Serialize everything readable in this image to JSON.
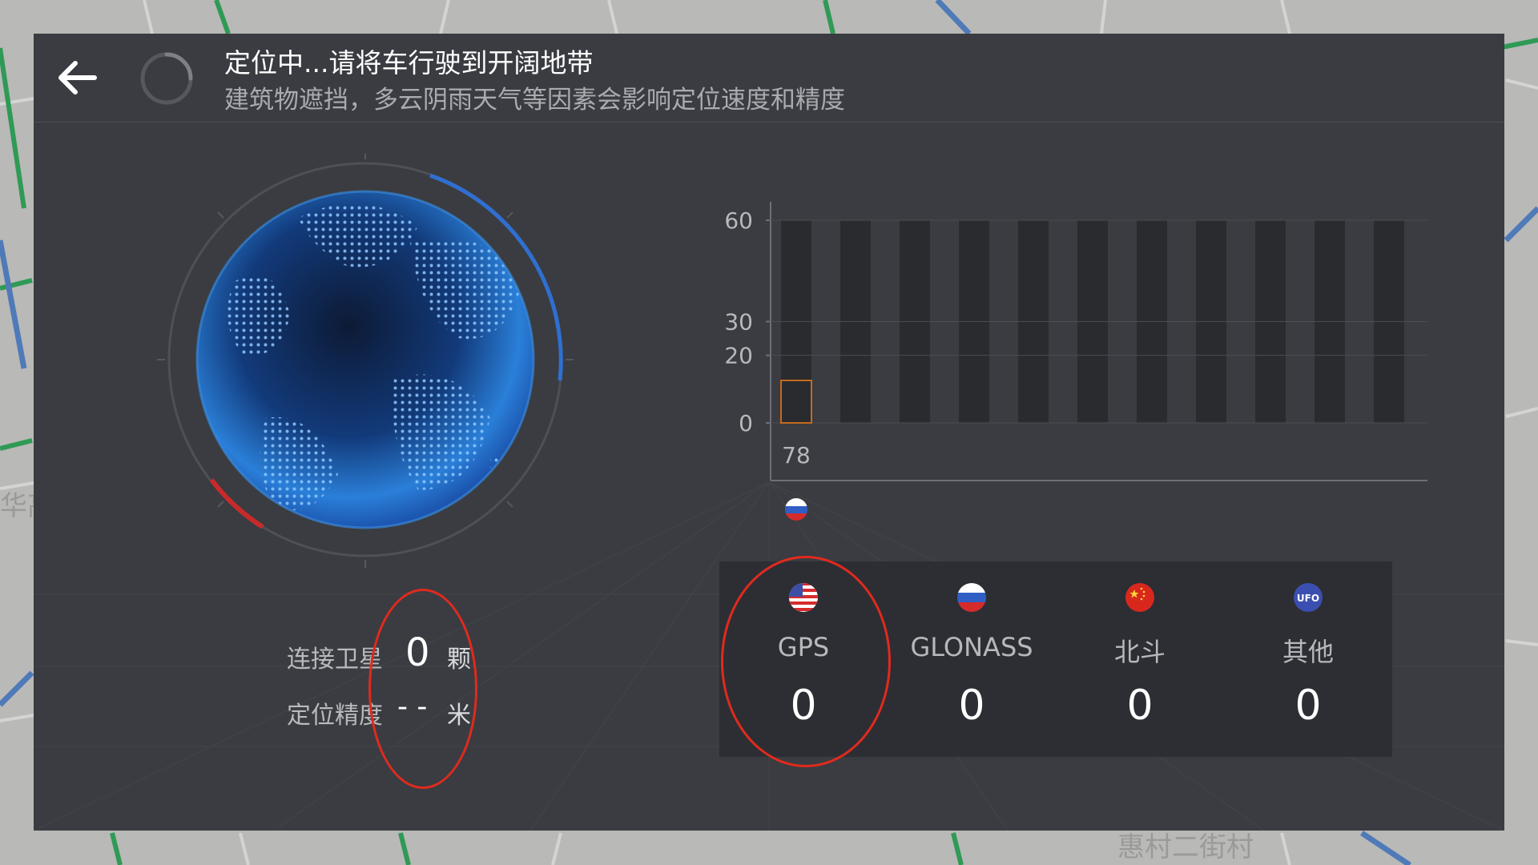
{
  "header": {
    "title": "定位中...请将车行驶到开阔地带",
    "subtitle": "建筑物遮挡，多云阴雨天气等因素会影响定位速度和精度"
  },
  "map_labels": [
    "华高",
    "惠村二街村"
  ],
  "stats": {
    "satellites_label": "连接卫星",
    "satellites_value": "0",
    "satellites_unit": "颗",
    "accuracy_label": "定位精度",
    "accuracy_value": "- -",
    "accuracy_unit": "米"
  },
  "chart_data": {
    "type": "bar",
    "title": "",
    "xlabel": "",
    "ylabel": "",
    "y_ticks": [
      "60",
      "30",
      "20",
      "0"
    ],
    "ylim": [
      0,
      60
    ],
    "categories": [
      "78",
      "",
      "",
      "",
      "",
      "",
      "",
      "",
      "",
      "",
      ""
    ],
    "values": [
      null,
      null,
      null,
      null,
      null,
      null,
      null,
      null,
      null,
      null,
      null
    ],
    "category_flags": [
      "glonass-flag"
    ],
    "grid": true,
    "colors": {
      "track": "#2a2b2f",
      "signal_outline": "#c46a1e"
    }
  },
  "counts": [
    {
      "name": "GPS",
      "value": "0",
      "icon": "us-flag-icon"
    },
    {
      "name": "GLONASS",
      "value": "0",
      "icon": "russia-flag-icon"
    },
    {
      "name": "北斗",
      "value": "0",
      "icon": "china-flag-icon"
    },
    {
      "name": "其他",
      "value": "0",
      "icon": "ufo-icon",
      "icon_text": "UFO"
    }
  ],
  "colors": {
    "panel": "#3a3c41",
    "globe": "#2c7fd6",
    "annotation": "#e02a1e",
    "arc_blue": "#2f6fd1",
    "arc_red": "#c82a2a"
  }
}
